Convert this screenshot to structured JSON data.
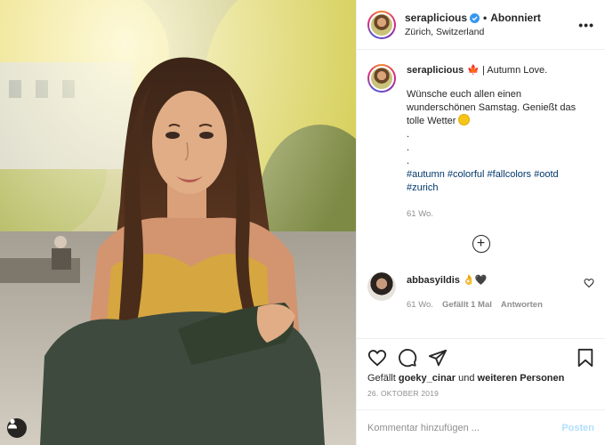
{
  "post": {
    "author": {
      "username": "seraplicious",
      "verified": true,
      "follow_separator": "•",
      "follow_status": "Abonniert",
      "location": "Zürich, Switzerland",
      "more_label": "•••"
    },
    "caption": {
      "username": "seraplicious",
      "emoji_icon": "maple-leaf-icon",
      "title": "🍁",
      "headline": "| Autumn Love.",
      "text": "Wünsche euch allen einen wunderschönen Samstag. Genießt das tolle Wetter",
      "sun_icon": "sun-emoji-icon",
      "dots": [
        ".",
        ".",
        "."
      ],
      "hashtags": [
        "#autumn",
        "#colorful",
        "#fallcolors",
        "#ootd",
        "#zurich"
      ],
      "time": "61 Wo."
    },
    "load_more_label": "+",
    "comments": [
      {
        "username": "abbasyildis",
        "text": "👌🖤",
        "time": "61 Wo.",
        "likes": "Gefällt 1 Mal",
        "reply": "Antworten"
      }
    ],
    "likes": {
      "prefix": "Gefällt",
      "user": "goeky_cinar",
      "connector": "und",
      "rest": "weiteren Personen"
    },
    "date": "26. OKTOBER 2019",
    "add_comment": {
      "placeholder": "Kommentar hinzufügen ...",
      "post_label": "Posten"
    },
    "colors": {
      "link": "#00376b",
      "verified": "#3897f0",
      "muted": "#8e8e8e",
      "post_button": "#b2dffc"
    }
  }
}
